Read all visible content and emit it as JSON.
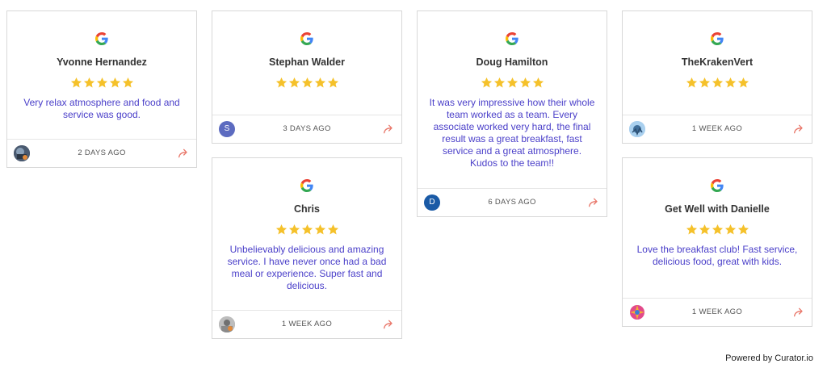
{
  "colors": {
    "star": "#f5c12a",
    "review_text": "#4a3fc9",
    "share": "#e9776a"
  },
  "reviews": [
    {
      "author": "Yvonne Hernandez",
      "rating": 5,
      "text": "Very relax atmosphere and food and service was good.",
      "time": "2 DAYS AGO",
      "avatar": "photo-avatar"
    },
    {
      "author": "Stephan Walder",
      "rating": 5,
      "text": "",
      "time": "3 DAYS AGO",
      "avatar_letter": "S"
    },
    {
      "author": "Chris",
      "rating": 5,
      "text": "Unbelievably delicious and amazing service. I have never once had a bad meal or experience. Super fast and delicious.",
      "time": "1 WEEK AGO",
      "avatar": "photo-avatar"
    },
    {
      "author": "Doug Hamilton",
      "rating": 5,
      "text": "It was very impressive how their whole team worked as a team. Every associate worked very hard, the final result was a great breakfast, fast service and a great atmosphere. Kudos to the team!!",
      "time": "6 DAYS AGO",
      "avatar_letter": "D"
    },
    {
      "author": "TheKrakenVert",
      "rating": 5,
      "text": "",
      "time": "1 WEEK AGO",
      "avatar": "photo-avatar"
    },
    {
      "author": "Get Well with Danielle",
      "rating": 5,
      "text": "Love the breakfast club! Fast service, delicious food, great with kids.",
      "time": "1 WEEK AGO",
      "avatar": "photo-avatar"
    }
  ],
  "footer": {
    "powered_by": "Powered by Curator.io"
  }
}
